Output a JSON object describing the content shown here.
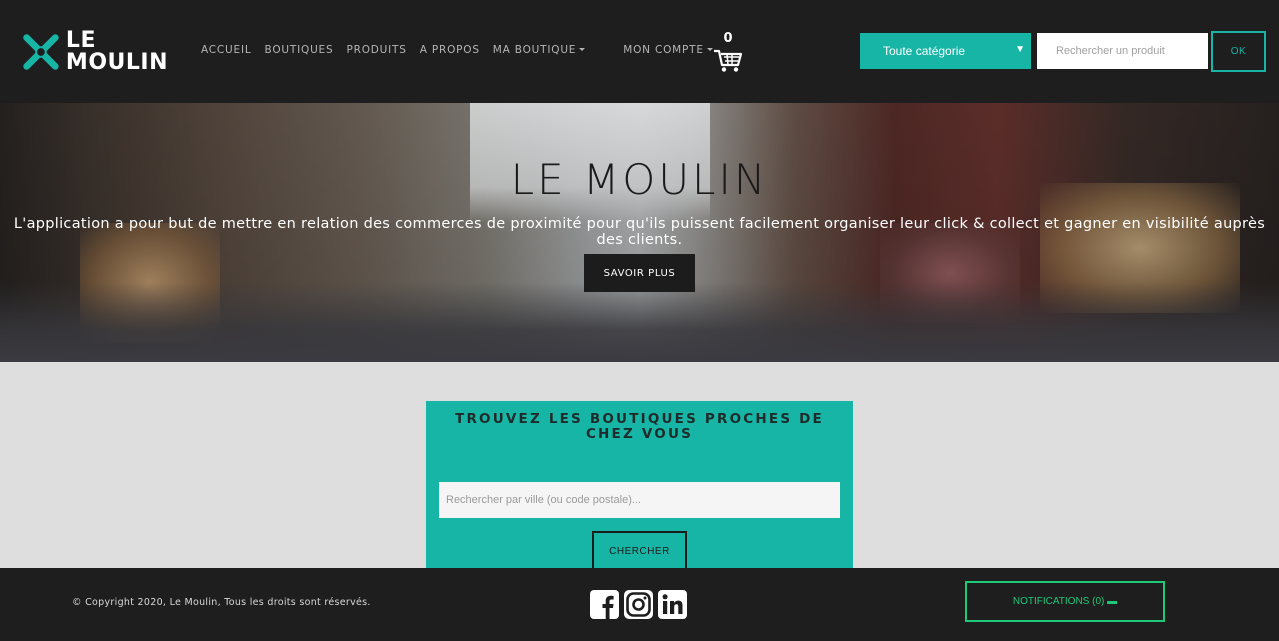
{
  "brand": {
    "line1": "LE",
    "line2": "MOULIN"
  },
  "nav": {
    "accueil": "ACCUEIL",
    "boutiques": "BOUTIQUES",
    "produits": "PRODUITS",
    "apropos": "A PROPOS",
    "maboutique": "MA BOUTIQUE",
    "moncompte": "MON COMPTE"
  },
  "cart": {
    "count": "0",
    "icon": "cart-icon"
  },
  "search": {
    "category_selected": "Toute catégorie",
    "placeholder": "Rechercher un produit",
    "ok_label": "OK"
  },
  "hero": {
    "title": "LE MOULIN",
    "subtitle": "L'application a pour but de mettre en relation des commerces de proximité pour qu'ils puissent facilement organiser leur click & collect et gagner en visibilité auprès des clients.",
    "cta": "SAVOIR PLUS"
  },
  "finder": {
    "title": "TROUVEZ LES BOUTIQUES PROCHES DE CHEZ VOUS",
    "placeholder": "Rechercher par ville (ou code postale)...",
    "button": "CHERCHER"
  },
  "footer": {
    "copyright": "© Copyright 2020, Le Moulin, Tous les droits sont réservés.",
    "socials": [
      "facebook-icon",
      "instagram-icon",
      "linkedin-icon"
    ],
    "notifications": "NOTIFICATIONS (0)"
  },
  "colors": {
    "accent": "#17b5a5",
    "dark": "#1e1e1e",
    "notif": "#1ec97a"
  }
}
